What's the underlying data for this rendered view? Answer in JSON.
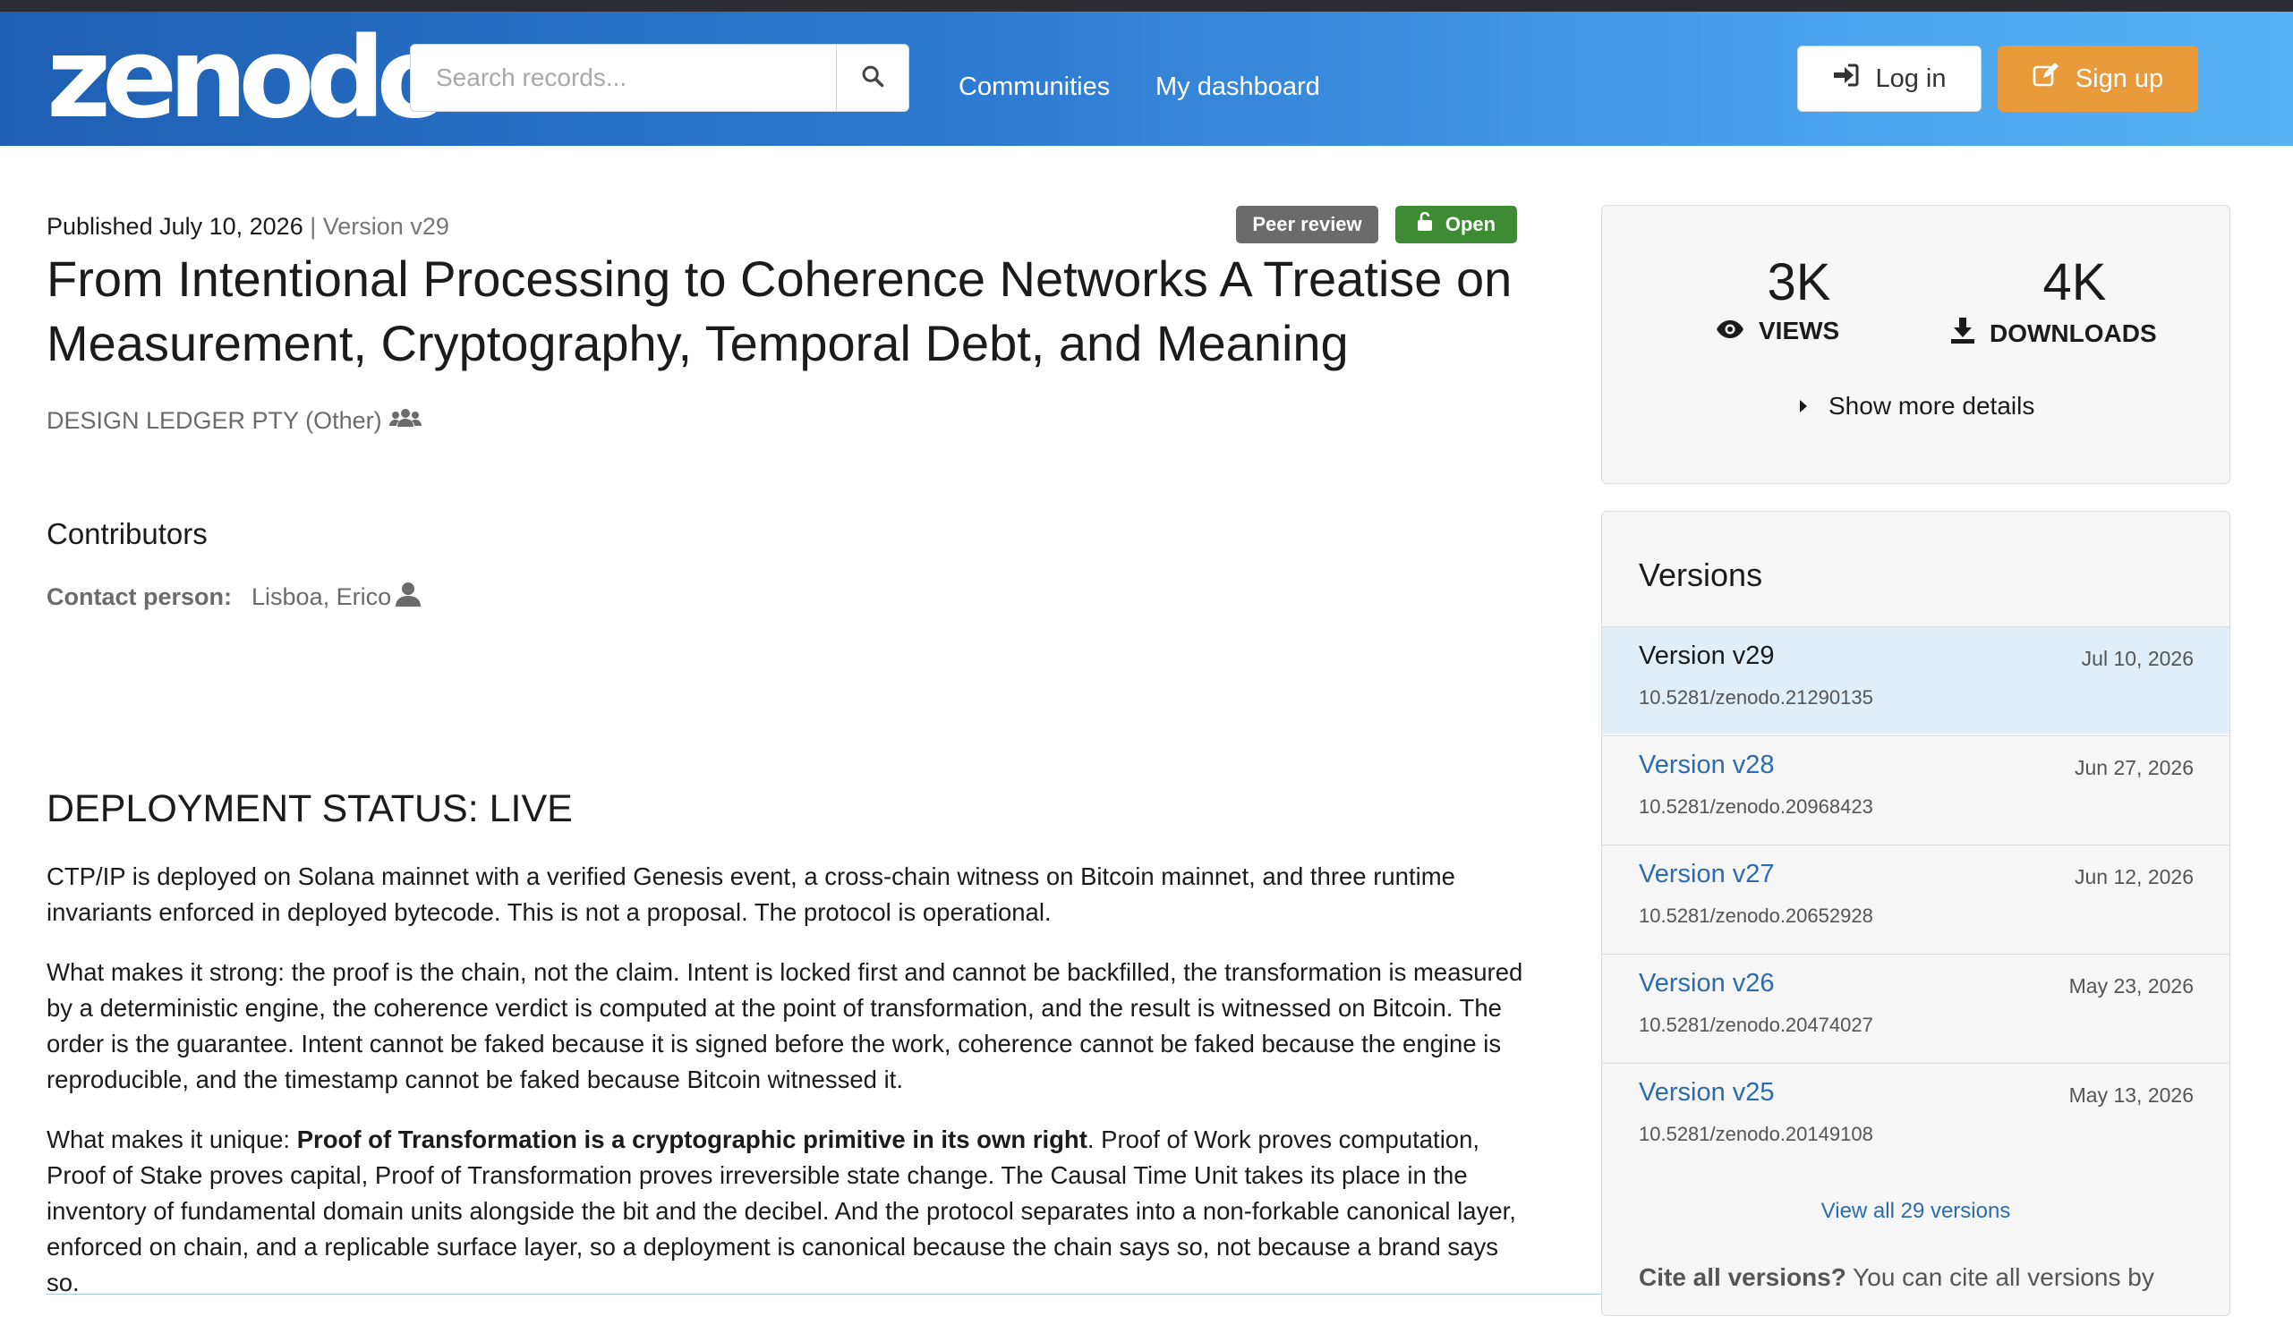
{
  "header": {
    "logo": "zenodo",
    "search_placeholder": "Search records...",
    "nav": [
      "Communities",
      "My dashboard"
    ],
    "login_label": "Log in",
    "signup_label": "Sign up"
  },
  "record": {
    "published": "Published July 10, 2026",
    "separator": "|",
    "version": "Version v29",
    "badges": {
      "peer_review": "Peer review",
      "open": "Open"
    },
    "title": "From Intentional Processing to Coherence Networks A Treatise on Measurement, Cryptography, Temporal Debt, and Meaning",
    "creator": "DESIGN LEDGER PTY (Other)",
    "contributors_heading": "Contributors",
    "contact_label": "Contact person:",
    "contact_name": "Lisboa, Erico",
    "section_heading": "DEPLOYMENT STATUS: LIVE",
    "paragraphs": [
      "CTP/IP is deployed on Solana mainnet with a verified Genesis event, a cross-chain witness on Bitcoin mainnet, and three runtime invariants enforced in deployed bytecode. This is not a proposal. The protocol is operational.",
      "What makes it strong: the proof is the chain, not the claim. Intent is locked first and cannot be backfilled, the transformation is measured by a deterministic engine, the coherence verdict is computed at the point of transformation, and the result is witnessed on Bitcoin. The order is the guarantee. Intent cannot be faked because it is signed before the work, coherence cannot be faked because the engine is reproducible, and the timestamp cannot be faked because Bitcoin witnessed it."
    ],
    "p3": {
      "prefix": "What makes it unique: ",
      "bold": "Proof of Transformation is a cryptographic primitive in its own right",
      "rest": ". Proof of Work proves computation, Proof of Stake proves capital, Proof of Transformation proves irreversible state change. The Causal Time Unit takes its place in the inventory of fundamental domain units alongside the bit and the decibel. And the protocol separates into a non-forkable canonical layer, enforced on chain, and a replicable surface layer, so a deployment is canonical because the chain says so, not because a brand says so."
    }
  },
  "stats": {
    "views": "3K",
    "views_label": "VIEWS",
    "downloads": "4K",
    "downloads_label": "DOWNLOADS",
    "more_details": "Show more details"
  },
  "versions": {
    "title": "Versions",
    "items": [
      {
        "name": "Version v29",
        "date": "Jul 10, 2026",
        "doi": "10.5281/zenodo.21290135"
      },
      {
        "name": "Version v28",
        "date": "Jun 27, 2026",
        "doi": "10.5281/zenodo.20968423"
      },
      {
        "name": "Version v27",
        "date": "Jun 12, 2026",
        "doi": "10.5281/zenodo.20652928"
      },
      {
        "name": "Version v26",
        "date": "May 23, 2026",
        "doi": "10.5281/zenodo.20474027"
      },
      {
        "name": "Version v25",
        "date": "May 13, 2026",
        "doi": "10.5281/zenodo.20149108"
      }
    ],
    "view_all": "View all 29 versions",
    "cite_bold": "Cite all versions?",
    "cite_rest": " You can cite all versions by"
  },
  "colors": {
    "header_start": "#1f5fb3",
    "header_end": "#56b2f4",
    "signup": "#e99a3b",
    "peer_review_badge": "#6b6b6b",
    "open_badge": "#3d8b33",
    "link": "#2b6cb0",
    "active_version_bg": "#e1edf7"
  },
  "icons": [
    "search-icon",
    "sign-in-icon",
    "edit-icon",
    "lock-open-icon",
    "group-icon",
    "user-icon",
    "eye-icon",
    "download-icon",
    "caret-right-icon"
  ]
}
